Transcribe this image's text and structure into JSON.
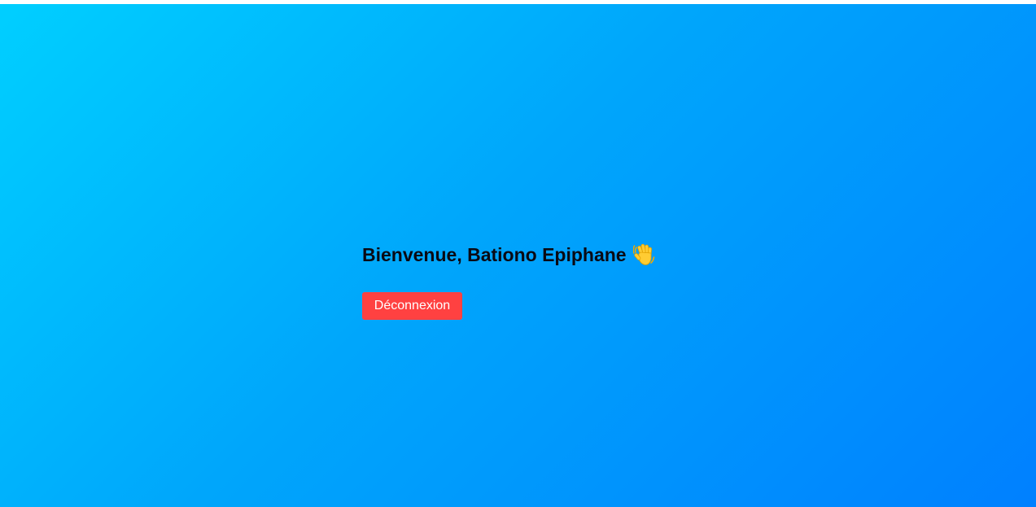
{
  "welcome": {
    "title": "Bienvenue, Bationo Epiphane",
    "icon": "waving-hand-icon"
  },
  "actions": {
    "logout_label": "Déconnexion"
  },
  "colors": {
    "gradient_start": "#00cfff",
    "gradient_end": "#0080ff",
    "logout_button": "#ff4141"
  }
}
